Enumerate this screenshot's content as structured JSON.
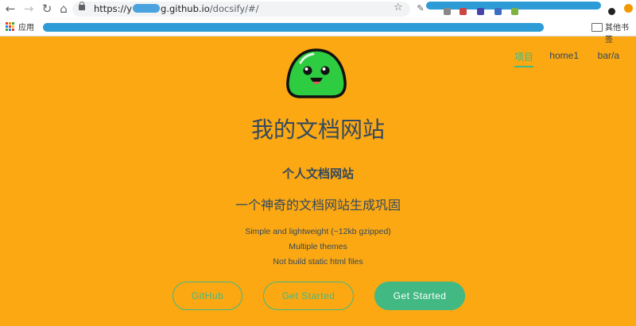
{
  "browser": {
    "url_prefix": "https://y",
    "url_host_suffix": "g.github.io",
    "url_path": "/docsify/#/",
    "apps_label": "应用",
    "other_bookmarks_label": "其他书签"
  },
  "nav": {
    "items": [
      "项目",
      "home1",
      "bar/a"
    ],
    "active_index": 0
  },
  "cover": {
    "title": "我的文档网站",
    "tagline": "个人文档网站",
    "subtitle": "一个神奇的文档网站生成巩固",
    "features": [
      "Simple and lightweight (~12kb gzipped)",
      "Multiple themes",
      "Not build static html files"
    ],
    "buttons": {
      "github": "GitHub",
      "get_started_outline": "Get Started",
      "get_started_primary": "Get Started"
    }
  },
  "colors": {
    "background": "#fba813",
    "accent": "#42b983",
    "text": "#34495e"
  }
}
